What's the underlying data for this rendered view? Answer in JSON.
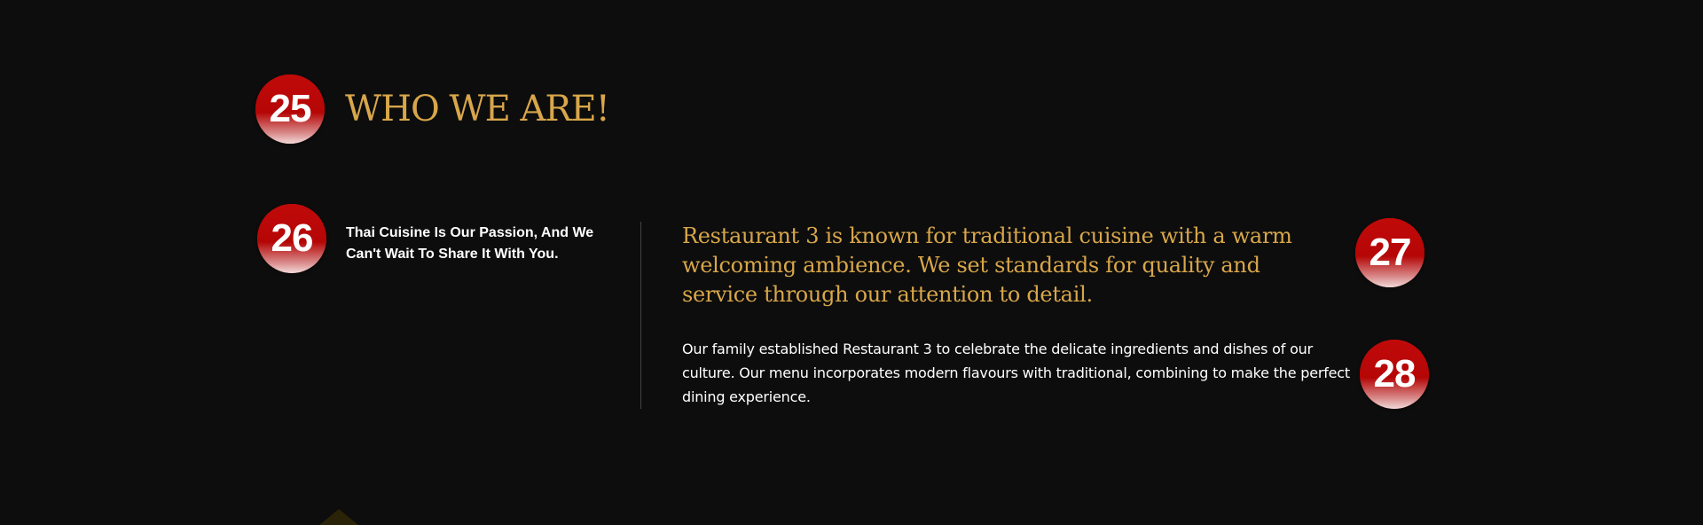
{
  "section": {
    "heading": "WHO WE ARE!",
    "tagline": "Thai Cuisine Is Our Passion, And We Can't Wait To Share It With You.",
    "lead": "Restaurant 3 is known for traditional cuisine with a warm welcoming ambience. We set standards for quality and service through our attention to detail.",
    "body": "Our family established Restaurant 3 to celebrate the delicate ingredients and dishes of our culture. Our menu incorporates modern flavours with traditional, combining to make the perfect dining experience."
  },
  "markers": {
    "heading": "25",
    "tagline": "26",
    "lead": "27",
    "body": "28"
  },
  "colors": {
    "background": "#0d0d0d",
    "gold": "#d8a64a",
    "badge_red": "#b50606",
    "text": "#ffffff"
  }
}
